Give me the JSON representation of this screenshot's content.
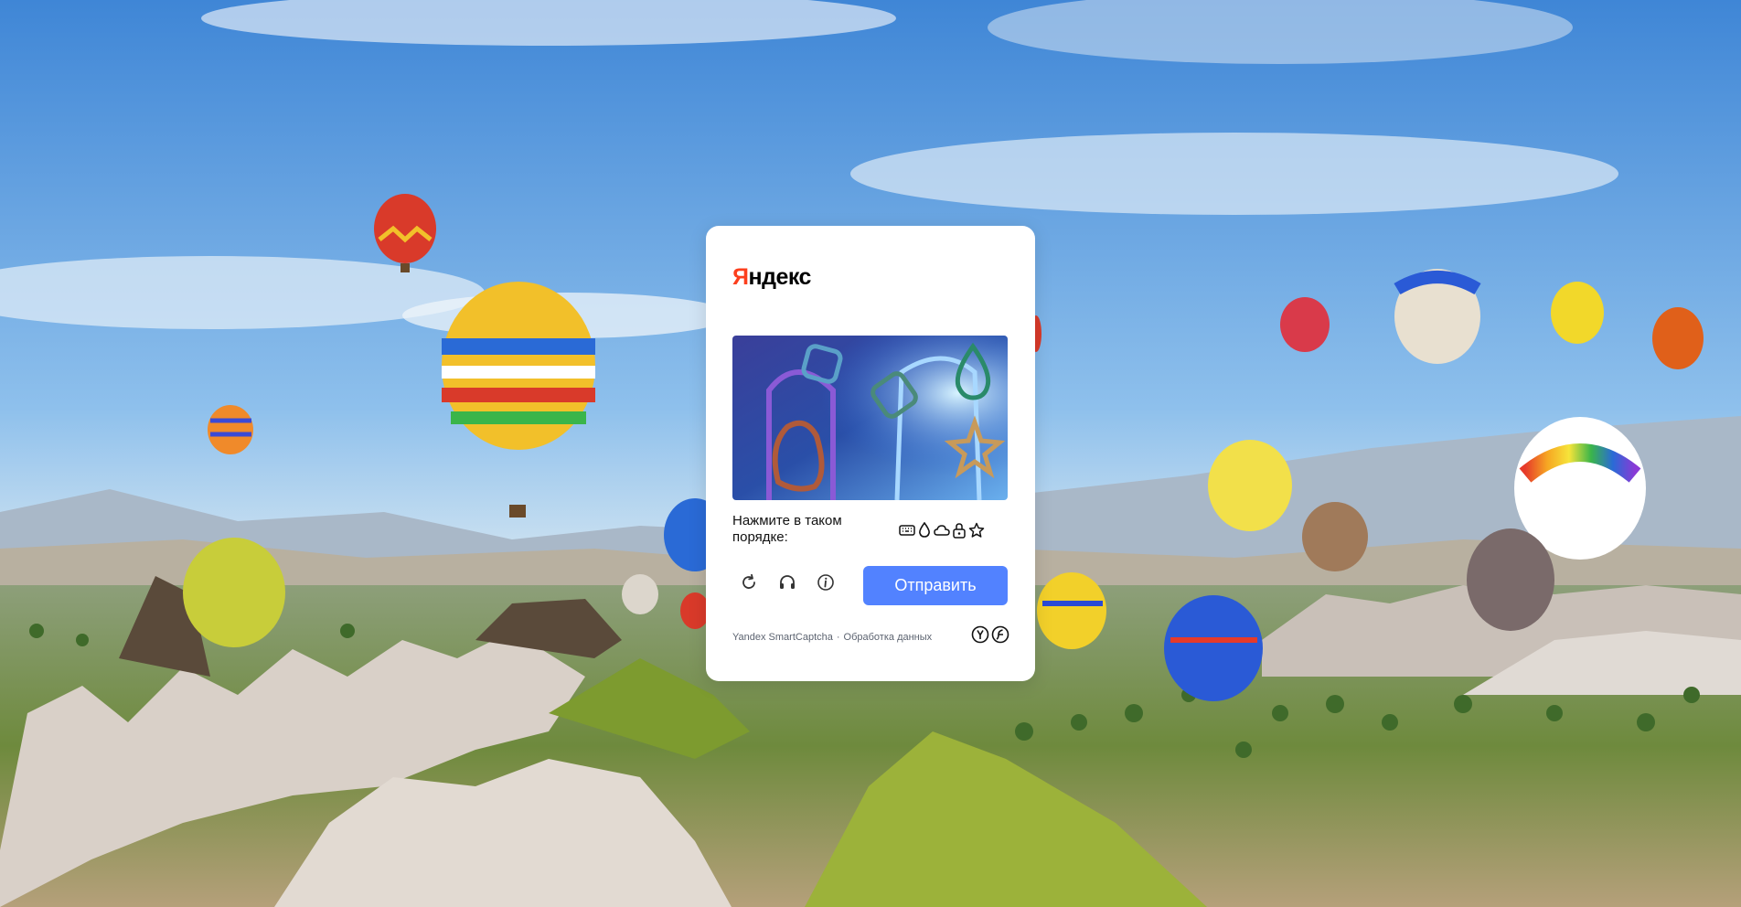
{
  "background": {
    "description_icon": "hot-air-balloons-landscape",
    "sky_color": "#5fa0de",
    "ground_color": "#8a9a5a"
  },
  "captcha": {
    "brand": "Яндекс",
    "brand_first_letter": "Я",
    "brand_rest": "ндекс",
    "brand_color": "#fc3f1d",
    "instruction": "Нажмите в таком порядке:",
    "order_icons": [
      "keyboard-icon",
      "drop-icon",
      "cloud-icon",
      "lock-icon",
      "star-icon"
    ],
    "tools": [
      "refresh-icon",
      "headphones-icon",
      "info-icon"
    ],
    "submit_label": "Отправить",
    "submit_color": "#5282ff",
    "footer_product": "Yandex SmartCaptcha",
    "footer_separator": "·",
    "footer_link": "Обработка данных",
    "footer_logo_icons": [
      "yandex-y-icon",
      "smartcaptcha-icon"
    ]
  }
}
